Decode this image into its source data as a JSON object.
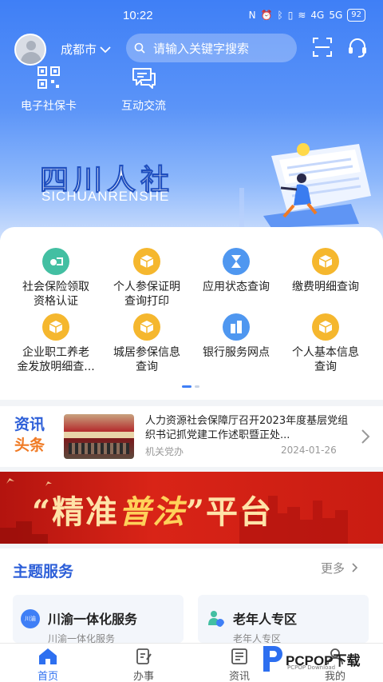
{
  "status_bar": {
    "time": "10:22",
    "battery": "92",
    "signal1": "4G",
    "signal2": "5G"
  },
  "header": {
    "city": "成都市",
    "search_placeholder": "请输入关键字搜索"
  },
  "quick_actions": [
    {
      "label": "电子社保卡",
      "icon": "qr-code-icon"
    },
    {
      "label": "互动交流",
      "icon": "chat-bubbles-icon"
    }
  ],
  "banner": {
    "title": "四川人社",
    "subtitle": "SICHUANRENSHE"
  },
  "services": [
    {
      "label_line1": "社会保险领取",
      "label_line2": "资格认证",
      "icon": "teal"
    },
    {
      "label_line1": "个人参保证明",
      "label_line2": "查询打印",
      "icon": "yellow"
    },
    {
      "label_line1": "应用状态查询",
      "label_line2": "",
      "icon": "blue"
    },
    {
      "label_line1": "缴费明细查询",
      "label_line2": "",
      "icon": "yellow"
    },
    {
      "label_line1": "企业职工养老",
      "label_line2": "金发放明细查...",
      "icon": "yellow"
    },
    {
      "label_line1": "城居参保信息",
      "label_line2": "查询",
      "icon": "yellow"
    },
    {
      "label_line1": "银行服务网点",
      "label_line2": "",
      "icon": "blue"
    },
    {
      "label_line1": "个人基本信息",
      "label_line2": "查询",
      "icon": "yellow"
    }
  ],
  "news": {
    "label_line1": "资讯",
    "label_line2": "头条",
    "title": "人力资源社会保障厅召开2023年度基层党组织书记抓党建工作述职暨正处...",
    "source": "机关党办",
    "date": "2024-01-26"
  },
  "promo": {
    "left": "“精准",
    "middle": "普法",
    "right": "”平台"
  },
  "theme": {
    "title": "主题服务",
    "more": "更多",
    "cards": [
      {
        "name": "川渝一体化服务",
        "sub": "川渝一体化服务",
        "badge": "川渝"
      },
      {
        "name": "老年人专区",
        "sub": "老年人专区"
      }
    ]
  },
  "nav": [
    {
      "label": "首页",
      "active": true
    },
    {
      "label": "办事",
      "active": false
    },
    {
      "label": "资讯",
      "active": false
    },
    {
      "label": "我的",
      "active": false
    }
  ],
  "watermark": {
    "text": "PCPOP下载",
    "sub": "PCPOP Download"
  },
  "colors": {
    "primary": "#3f7ff6",
    "accent": "#f07a24",
    "promo_red": "#d92417"
  }
}
